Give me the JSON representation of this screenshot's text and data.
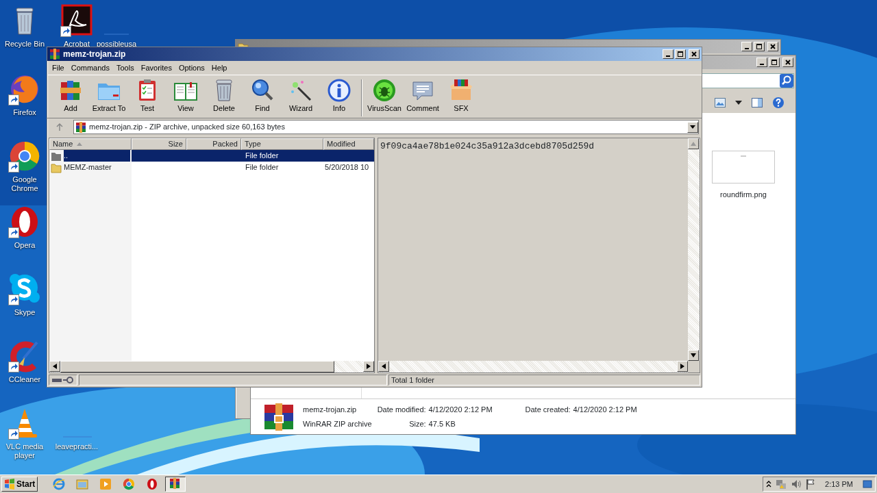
{
  "desktop_icons": [
    {
      "label": "Recycle Bin",
      "shortcut": false
    },
    {
      "label": "Acrobat",
      "shortcut": true
    },
    {
      "label": "possibleusa",
      "shortcut": false
    },
    {
      "label": "Firefox",
      "shortcut": true
    },
    {
      "label": "Google Chrome",
      "shortcut": true
    },
    {
      "label": "Opera",
      "shortcut": true
    },
    {
      "label": "Skype",
      "shortcut": true
    },
    {
      "label": "CCleaner",
      "shortcut": true
    },
    {
      "label": "VLC media player",
      "shortcut": true
    },
    {
      "label": "leavepracti...",
      "shortcut": false
    }
  ],
  "explorer_window": {
    "files": [
      {
        "name": "roundfirm.png"
      }
    ],
    "details": {
      "name": "memz-trojan.zip",
      "type": "WinRAR ZIP archive",
      "fields": [
        {
          "label": "Date modified:",
          "value": "4/12/2020 2:12 PM"
        },
        {
          "label": "Date created:",
          "value": "4/12/2020 2:12 PM"
        },
        {
          "label": "Size:",
          "value": "47.5 KB"
        }
      ]
    }
  },
  "winrar": {
    "title": "memz-trojan.zip",
    "menu": [
      "File",
      "Commands",
      "Tools",
      "Favorites",
      "Options",
      "Help"
    ],
    "toolbar": [
      {
        "label": "Add"
      },
      {
        "label": "Extract To"
      },
      {
        "label": "Test"
      },
      {
        "label": "View"
      },
      {
        "label": "Delete"
      },
      {
        "label": "Find"
      },
      {
        "label": "Wizard"
      },
      {
        "label": "Info"
      },
      {
        "label": "VirusScan"
      },
      {
        "label": "Comment"
      },
      {
        "label": "SFX"
      }
    ],
    "address": "memz-trojan.zip - ZIP archive, unpacked size 60,163 bytes",
    "columns": [
      {
        "label": "Name",
        "sorted": true
      },
      {
        "label": "Size",
        "sorted": false
      },
      {
        "label": "Packed",
        "sorted": false
      },
      {
        "label": "Type",
        "sorted": false
      },
      {
        "label": "Modified",
        "sorted": false
      }
    ],
    "rows": [
      {
        "kind": "parent",
        "name": "..",
        "type": "File folder",
        "selected": true
      },
      {
        "kind": "folder",
        "name": "MEMZ-master",
        "type": "File folder",
        "modified": "5/20/2018 10",
        "selected": false
      }
    ],
    "comment": "9f09ca4ae78b1e024c35a912a3dcebd8705d259d",
    "status": "Total 1 folder"
  },
  "taskbar": {
    "start": "Start",
    "apps": [
      {
        "selected": false
      },
      {
        "selected": false
      },
      {
        "selected": false
      },
      {
        "selected": false
      },
      {
        "selected": false
      },
      {
        "selected": true
      }
    ],
    "clock": "2:13 PM"
  }
}
